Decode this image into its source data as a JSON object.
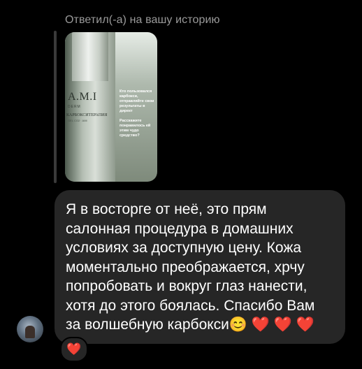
{
  "reply": {
    "header": "Ответил(-а) на вашу историю"
  },
  "story": {
    "bottle_logo": "A.M.I",
    "bottle_sub": "DERM",
    "bottle_name": "КАРБОКСИТЕРАПИЯ",
    "bottle_sub2": "GEL CO2 · AMI",
    "text1": "Кто пользовался карбокси, отправляйте свои результаты в директ",
    "text2": "Расскажите понравилось ей этим чудо средство?"
  },
  "message": {
    "text": "Я в восторге от неё,  это прям\nсалонная процедура в домашних\nусловиях за доступную цену. Кожа\nмоментально преображается, хрчу\nпопробовать и вокруг глаз нанести,\nхотя до этого боялась. Спасибо Вам\nза волшебную карбокси😊 ❤️ ❤️ ❤️"
  },
  "reaction": {
    "emoji": "❤️"
  },
  "icons": {
    "avatar": "user-avatar",
    "heart": "heart-icon"
  }
}
